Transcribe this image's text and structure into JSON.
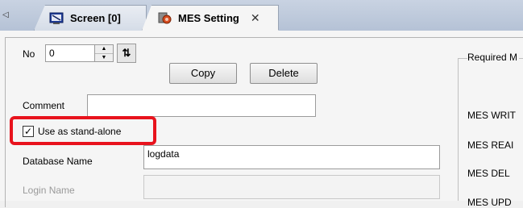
{
  "tabs": {
    "scroll_glyph": "◁",
    "screen_label": "Screen [0]",
    "screen_icon": "screen-icon",
    "mes_label": "MES Setting",
    "mes_icon": "mes-setting-icon",
    "close_glyph": "✕"
  },
  "form": {
    "no_label": "No",
    "no_value": "0",
    "copy_label": "Copy",
    "delete_label": "Delete",
    "comment_label": "Comment",
    "comment_value": "",
    "standalone_label": "Use as stand-alone",
    "standalone_checked": true,
    "db_name_label": "Database Name",
    "db_name_value": "logdata",
    "login_label": "Login Name",
    "login_value": ""
  },
  "right_panel": {
    "group_title": "Required M",
    "write_label": "MES WRIT",
    "read_label": "MES REAI",
    "del_label": "MES DEL",
    "upd_label": "MES UPD"
  },
  "colors": {
    "highlight": "#e8131d",
    "tabbar": "#c0cbdb"
  }
}
